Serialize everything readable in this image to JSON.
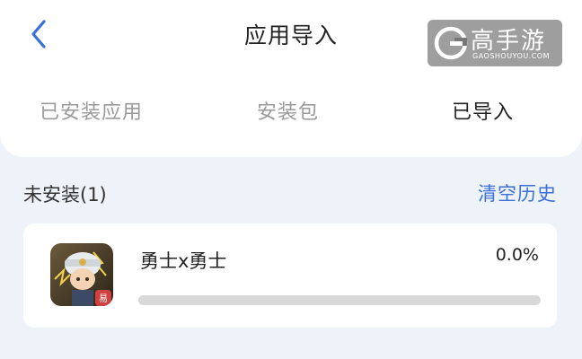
{
  "header": {
    "title": "应用导入",
    "back_icon": "chevron-left-icon",
    "accent_color": "#3a6fd8"
  },
  "watermark": {
    "text": "高手游",
    "subtext": "GAOSHOUYOU.COM"
  },
  "tabs": [
    {
      "label": "已安装应用",
      "active": false
    },
    {
      "label": "安装包",
      "active": false
    },
    {
      "label": "已导入",
      "active": true
    }
  ],
  "section": {
    "title": "未安装(1)",
    "clear_label": "清空历史"
  },
  "apps": [
    {
      "name": "勇士x勇士",
      "percent_label": "0.0%",
      "progress": 0.0
    }
  ]
}
